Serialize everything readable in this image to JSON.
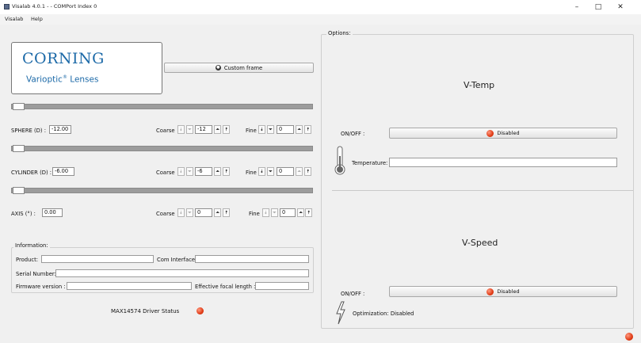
{
  "window": {
    "title": "Visalab 4.0.1 -  - COMPort Index 0",
    "controls": [
      "–",
      "□",
      "✕"
    ]
  },
  "menu": {
    "items": [
      "Visalab",
      "Help"
    ]
  },
  "logo": {
    "line1": "CORNING",
    "line2_main": "Varioptic",
    "line2_sup": "®",
    "line2_tail": " Lenses"
  },
  "custom_frame": {
    "label": "Custom frame"
  },
  "sphere": {
    "label": "SPHERE (D) :",
    "value": "-12.00",
    "coarse_label": "Coarse",
    "coarse_value": "-12",
    "fine_label": "Fine",
    "fine_value": "0"
  },
  "cylinder": {
    "label": "CYLINDER (D) :",
    "value": "-6.00",
    "coarse_label": "Coarse",
    "coarse_value": "-6",
    "fine_label": "Fine",
    "fine_value": "0"
  },
  "axis": {
    "label": "AXIS (°) :",
    "value": "0.00",
    "coarse_label": "Coarse",
    "coarse_value": "0",
    "fine_label": "Fine",
    "fine_value": "0"
  },
  "information": {
    "title": "Information:",
    "product_label": "Product:",
    "com_label": "Com Interface:",
    "serial_label": "Serial Number:",
    "firmware_label": "Firmware version :",
    "efl_label": "Effective focal length :"
  },
  "driver_status": {
    "label": "MAX14574 Driver Status"
  },
  "options": {
    "title": "Options:",
    "vtemp": {
      "title": "V-Temp",
      "onoff_label": "ON/OFF :",
      "button_label": "Disabled",
      "temperature_label": "Temperature:"
    },
    "vspeed": {
      "title": "V-Speed",
      "onoff_label": "ON/OFF :",
      "button_label": "Disabled",
      "optimization_text": "Optimization: Disabled"
    }
  },
  "icons": {
    "down_double": "⯯",
    "down": "⏷",
    "up": "⏶",
    "up_double": "⯭",
    "thermometer": "thermometer-icon",
    "lightning": "lightning-icon"
  },
  "colors": {
    "led_red": "#e03b16",
    "logo_blue": "#1d6aa8",
    "slider_gray": "#9c9c9c"
  }
}
